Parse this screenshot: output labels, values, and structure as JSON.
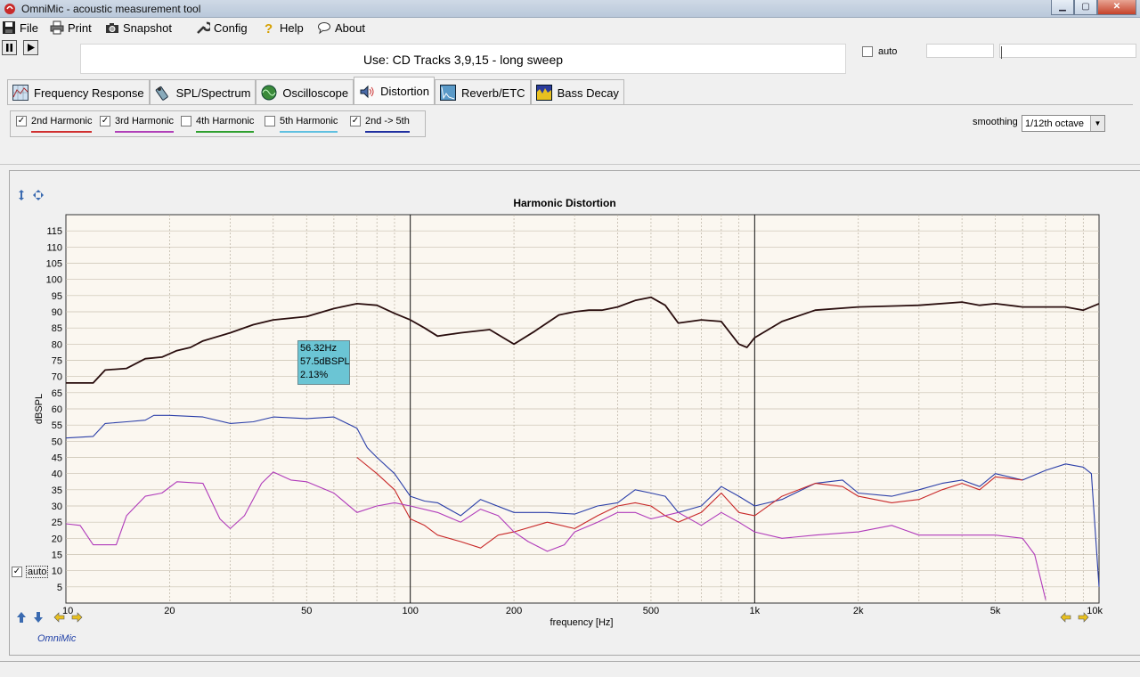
{
  "window": {
    "title": "OmniMic - acoustic measurement tool"
  },
  "menu": {
    "file": "File",
    "print": "Print",
    "snapshot": "Snapshot",
    "config": "Config",
    "help": "Help",
    "about": "About"
  },
  "instruction": "Use: CD Tracks 3,9,15 - long sweep",
  "top_auto_label": "auto",
  "tabs": [
    {
      "label": "Frequency Response"
    },
    {
      "label": "SPL/Spectrum"
    },
    {
      "label": "Oscilloscope"
    },
    {
      "label": "Distortion"
    },
    {
      "label": "Reverb/ETC"
    },
    {
      "label": "Bass Decay"
    }
  ],
  "harmonics": [
    {
      "label": "2nd Harmonic",
      "checked": true,
      "color": "#d03030"
    },
    {
      "label": "3rd Harmonic",
      "checked": true,
      "color": "#b040b8"
    },
    {
      "label": "4th Harmonic",
      "checked": false,
      "color": "#30a030"
    },
    {
      "label": "5th Harmonic",
      "checked": false,
      "color": "#60c0e0"
    },
    {
      "label": "2nd -> 5th",
      "checked": true,
      "color": "#2030a0"
    }
  ],
  "smoothing": {
    "label": "smoothing",
    "value": "1/12th octave"
  },
  "bottom_auto_label": "auto",
  "brand": "OmniMic",
  "tooltip": {
    "freq": "56.32Hz",
    "level": "57.5dBSPL",
    "pct": "2.13%"
  },
  "chart_data": {
    "type": "line",
    "title": "Harmonic Distortion",
    "xlabel": "frequency [Hz]",
    "ylabel": "dBSPL",
    "xscale": "log",
    "xlim": [
      10,
      10000
    ],
    "ylim": [
      0,
      120
    ],
    "yticks": [
      5,
      10,
      15,
      20,
      25,
      30,
      35,
      40,
      45,
      50,
      55,
      60,
      65,
      70,
      75,
      80,
      85,
      90,
      95,
      100,
      105,
      110,
      115
    ],
    "xtick_labels": [
      {
        "x": 10,
        "label": "10"
      },
      {
        "x": 20,
        "label": "20"
      },
      {
        "x": 50,
        "label": "50"
      },
      {
        "x": 100,
        "label": "100"
      },
      {
        "x": 200,
        "label": "200"
      },
      {
        "x": 500,
        "label": "500"
      },
      {
        "x": 1000,
        "label": "1k"
      },
      {
        "x": 2000,
        "label": "2k"
      },
      {
        "x": 5000,
        "label": "5k"
      },
      {
        "x": 10000,
        "label": "10k"
      }
    ],
    "grid": true,
    "series": [
      {
        "color": "#2a0e0e",
        "points": [
          [
            10,
            68
          ],
          [
            12,
            68
          ],
          [
            13,
            72
          ],
          [
            15,
            72.5
          ],
          [
            17,
            75.5
          ],
          [
            19,
            76
          ],
          [
            21,
            78
          ],
          [
            23,
            79
          ],
          [
            25,
            81
          ],
          [
            30,
            83.5
          ],
          [
            35,
            86
          ],
          [
            40,
            87.5
          ],
          [
            50,
            88.5
          ],
          [
            60,
            91
          ],
          [
            70,
            92.5
          ],
          [
            80,
            92
          ],
          [
            90,
            89.5
          ],
          [
            100,
            87.5
          ],
          [
            110,
            85
          ],
          [
            120,
            82.5
          ],
          [
            140,
            83.5
          ],
          [
            170,
            84.5
          ],
          [
            200,
            80
          ],
          [
            230,
            84
          ],
          [
            270,
            89
          ],
          [
            300,
            90
          ],
          [
            330,
            90.5
          ],
          [
            360,
            90.5
          ],
          [
            400,
            91.5
          ],
          [
            450,
            93.5
          ],
          [
            500,
            94.5
          ],
          [
            550,
            92
          ],
          [
            600,
            86.5
          ],
          [
            700,
            87.5
          ],
          [
            800,
            87
          ],
          [
            900,
            80
          ],
          [
            950,
            79
          ],
          [
            1000,
            82
          ],
          [
            1200,
            87
          ],
          [
            1500,
            90.5
          ],
          [
            2000,
            91.5
          ],
          [
            3000,
            92
          ],
          [
            4000,
            93
          ],
          [
            4500,
            92
          ],
          [
            5000,
            92.5
          ],
          [
            6000,
            91.5
          ],
          [
            7000,
            91.5
          ],
          [
            8000,
            91.5
          ],
          [
            9000,
            90.5
          ],
          [
            10000,
            92.5
          ]
        ]
      },
      {
        "color": "#2a3ea8",
        "points": [
          [
            10,
            51
          ],
          [
            12,
            51.5
          ],
          [
            13,
            55.5
          ],
          [
            15,
            56
          ],
          [
            17,
            56.5
          ],
          [
            18,
            58
          ],
          [
            20,
            58
          ],
          [
            25,
            57.5
          ],
          [
            30,
            55.5
          ],
          [
            35,
            56
          ],
          [
            40,
            57.5
          ],
          [
            50,
            57
          ],
          [
            60,
            57.5
          ],
          [
            70,
            54
          ],
          [
            75,
            48
          ],
          [
            80,
            45
          ],
          [
            90,
            40
          ],
          [
            100,
            33
          ],
          [
            110,
            31.5
          ],
          [
            120,
            31
          ],
          [
            140,
            27
          ],
          [
            160,
            32
          ],
          [
            200,
            28
          ],
          [
            250,
            28
          ],
          [
            300,
            27.5
          ],
          [
            350,
            30
          ],
          [
            400,
            31
          ],
          [
            450,
            35
          ],
          [
            500,
            34
          ],
          [
            550,
            33
          ],
          [
            600,
            28
          ],
          [
            700,
            30
          ],
          [
            800,
            36
          ],
          [
            900,
            33
          ],
          [
            1000,
            30
          ],
          [
            1200,
            32
          ],
          [
            1500,
            37
          ],
          [
            1800,
            38
          ],
          [
            2000,
            34
          ],
          [
            2500,
            33
          ],
          [
            3000,
            35
          ],
          [
            3500,
            37
          ],
          [
            4000,
            38
          ],
          [
            4500,
            36
          ],
          [
            5000,
            40
          ],
          [
            6000,
            38
          ],
          [
            7000,
            41
          ],
          [
            8000,
            43
          ],
          [
            9000,
            42
          ],
          [
            9500,
            40
          ],
          [
            10000,
            5
          ]
        ]
      },
      {
        "color": "#c82828",
        "points": [
          [
            70,
            45
          ],
          [
            80,
            40
          ],
          [
            90,
            35
          ],
          [
            100,
            26
          ],
          [
            110,
            24
          ],
          [
            120,
            21
          ],
          [
            140,
            19
          ],
          [
            160,
            17
          ],
          [
            180,
            21
          ],
          [
            200,
            22
          ],
          [
            250,
            25
          ],
          [
            300,
            23
          ],
          [
            350,
            27
          ],
          [
            400,
            30
          ],
          [
            450,
            31
          ],
          [
            500,
            30
          ],
          [
            550,
            27
          ],
          [
            600,
            25
          ],
          [
            700,
            28
          ],
          [
            800,
            34
          ],
          [
            900,
            28
          ],
          [
            1000,
            27
          ],
          [
            1200,
            33
          ],
          [
            1500,
            37
          ],
          [
            1800,
            36
          ],
          [
            2000,
            33
          ],
          [
            2500,
            31
          ],
          [
            3000,
            32
          ],
          [
            3500,
            35
          ],
          [
            4000,
            37
          ],
          [
            4500,
            35
          ],
          [
            5000,
            39
          ],
          [
            6000,
            38
          ]
        ]
      },
      {
        "color": "#b03aba",
        "points": [
          [
            10,
            24.5
          ],
          [
            11,
            24
          ],
          [
            12,
            18
          ],
          [
            14,
            18
          ],
          [
            15,
            27
          ],
          [
            17,
            33
          ],
          [
            19,
            34
          ],
          [
            21,
            37.5
          ],
          [
            25,
            37
          ],
          [
            28,
            26
          ],
          [
            30,
            23
          ],
          [
            33,
            27
          ],
          [
            37,
            37
          ],
          [
            40,
            40.5
          ],
          [
            45,
            38
          ],
          [
            50,
            37.5
          ],
          [
            60,
            34
          ],
          [
            70,
            28
          ],
          [
            80,
            30
          ],
          [
            90,
            31
          ],
          [
            100,
            30
          ],
          [
            120,
            28
          ],
          [
            140,
            25
          ],
          [
            160,
            29
          ],
          [
            180,
            27
          ],
          [
            200,
            22
          ],
          [
            220,
            19
          ],
          [
            250,
            16
          ],
          [
            280,
            18
          ],
          [
            300,
            22
          ],
          [
            350,
            25
          ],
          [
            400,
            28
          ],
          [
            450,
            28
          ],
          [
            500,
            26
          ],
          [
            600,
            28
          ],
          [
            700,
            24
          ],
          [
            800,
            28
          ],
          [
            900,
            25
          ],
          [
            1000,
            22
          ],
          [
            1200,
            20
          ],
          [
            1500,
            21
          ],
          [
            2000,
            22
          ],
          [
            2500,
            24
          ],
          [
            3000,
            21
          ],
          [
            4000,
            21
          ],
          [
            5000,
            21
          ],
          [
            6000,
            20
          ],
          [
            6500,
            15
          ],
          [
            7000,
            1
          ]
        ]
      }
    ]
  }
}
